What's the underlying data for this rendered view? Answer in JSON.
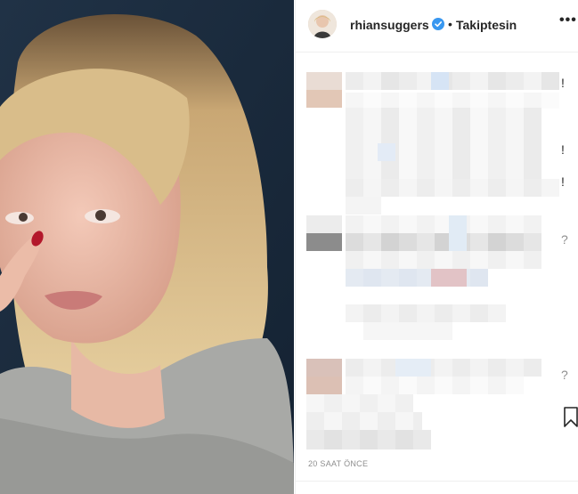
{
  "post": {
    "username": "rhiansuggers",
    "separator": "•",
    "follow_status": "Takiptesin",
    "timestamp": "20 SAAT ÖNCE",
    "more_glyph": "•••"
  },
  "comments_edge_glyphs": [
    "!",
    "!",
    "!",
    "?",
    "?"
  ],
  "icons": {
    "verified": "verified-badge-icon",
    "more": "more-options-icon",
    "bookmark": "bookmark-icon"
  },
  "colors": {
    "verified_blue": "#3897f0",
    "text": "#262626",
    "muted": "#8e8e8e",
    "photo_bg": "#1b2a3c"
  }
}
